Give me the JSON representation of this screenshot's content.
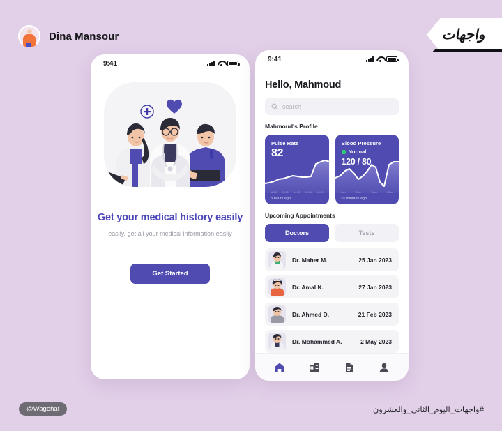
{
  "author": {
    "name": "Dina Mansour",
    "avatar_icon": "person-avatar-icon"
  },
  "brand": {
    "ribbon_text": "واجهات"
  },
  "phone1": {
    "status": {
      "time": "9:41",
      "signal_icon": "signal-bars-icon",
      "wifi_icon": "wifi-icon",
      "battery_icon": "battery-icon"
    },
    "illustration_name": "medical-team-illustration",
    "title": "Get your medical history easily",
    "subtitle": "easily, get all your medical\ninformation easily",
    "cta_label": "Get Started"
  },
  "phone2": {
    "status": {
      "time": "9:41",
      "signal_icon": "signal-bars-icon",
      "wifi_icon": "wifi-icon",
      "battery_icon": "battery-icon"
    },
    "greeting": "Hello, Mahmoud",
    "search": {
      "placeholder": "search",
      "value": "",
      "icon": "search-icon"
    },
    "profile_label": "Mahmoud's Profile",
    "cards": [
      {
        "title": "Pulse Rate",
        "value": "82",
        "status": null,
        "time": "3 hours ago"
      },
      {
        "title": "Blood Pressure",
        "value": "120 / 80",
        "status": "Normal",
        "status_color": "#2ecb6e",
        "time": "10 minutes ago"
      }
    ],
    "appointments_label": "Upcoming Appointments",
    "tabs": [
      {
        "label": "Doctors",
        "active": true
      },
      {
        "label": "Tests",
        "active": false
      }
    ],
    "appointments": [
      {
        "name": "Dr. Maher M.",
        "date": "25 Jan 2023"
      },
      {
        "name": "Dr. Amal K.",
        "date": "27 Jan 2023"
      },
      {
        "name": "Dr. Ahmed D.",
        "date": "21 Feb 2023"
      },
      {
        "name": "Dr. Mohammed A.",
        "date": "2 May 2023"
      }
    ],
    "nav": [
      {
        "icon": "home-icon",
        "active": true
      },
      {
        "icon": "hospital-icon",
        "active": false
      },
      {
        "icon": "document-icon",
        "active": false
      },
      {
        "icon": "person-icon",
        "active": false
      }
    ]
  },
  "footer": {
    "handle": "@Wagehat",
    "hashtag": "#واجهات_اليوم_الثاني_والعشرون"
  },
  "colors": {
    "background": "#e2cfe8",
    "accent": "#4f4bb0",
    "title_purple": "#4a46b8",
    "status_green": "#2ecb6e"
  },
  "chart_data": [
    {
      "type": "line",
      "title": "Pulse Rate",
      "x": [
        0,
        1,
        2,
        3,
        4,
        5,
        6,
        7,
        8,
        9,
        10,
        11,
        12,
        13,
        14,
        15
      ],
      "values": [
        26,
        25,
        23,
        21,
        20,
        19,
        17,
        18,
        19,
        19,
        18,
        8,
        6,
        5,
        6,
        11
      ],
      "xticks": [
        "12:00",
        "13:00",
        "14:00",
        "15:00",
        "16:00"
      ],
      "ylabel": "",
      "xlabel": "",
      "grid": false,
      "legend": false
    },
    {
      "type": "line",
      "title": "Blood Pressure",
      "x": [
        0,
        1,
        2,
        3,
        4,
        5,
        6,
        7,
        8,
        9,
        10,
        11,
        12,
        13,
        14,
        15
      ],
      "values": [
        22,
        24,
        30,
        32,
        26,
        20,
        24,
        30,
        38,
        34,
        16,
        11,
        8,
        7,
        7,
        8
      ],
      "xticks": [
        "9pm",
        "10pm",
        "11pm",
        "12am"
      ],
      "ylabel": "",
      "xlabel": "",
      "grid": false,
      "legend": false
    }
  ]
}
